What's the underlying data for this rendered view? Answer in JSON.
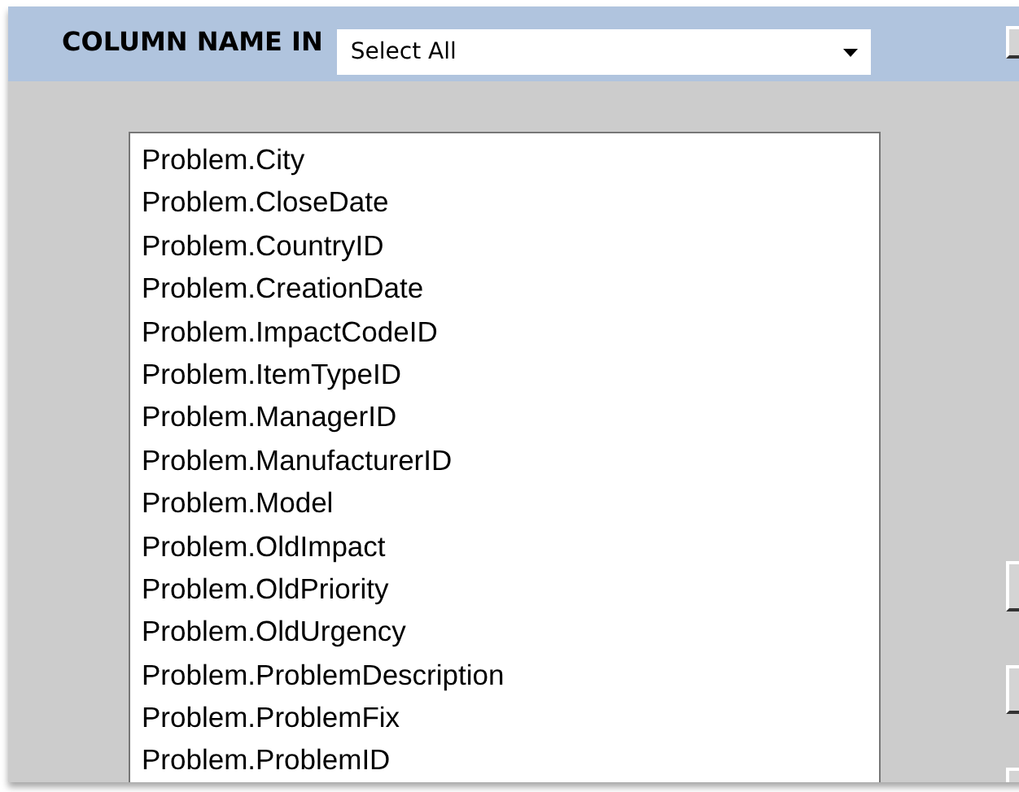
{
  "header": {
    "label": "COLUMN NAME IN",
    "select": {
      "value": "Select All"
    }
  },
  "columns": [
    "Problem.City",
    "Problem.CloseDate",
    "Problem.CountryID",
    "Problem.CreationDate",
    "Problem.ImpactCodeID",
    "Problem.ItemTypeID",
    "Problem.ManagerID",
    "Problem.ManufacturerID",
    "Problem.Model",
    "Problem.OldImpact",
    "Problem.OldPriority",
    "Problem.OldUrgency",
    "Problem.ProblemDescription",
    "Problem.ProblemFix",
    "Problem.ProblemID"
  ]
}
